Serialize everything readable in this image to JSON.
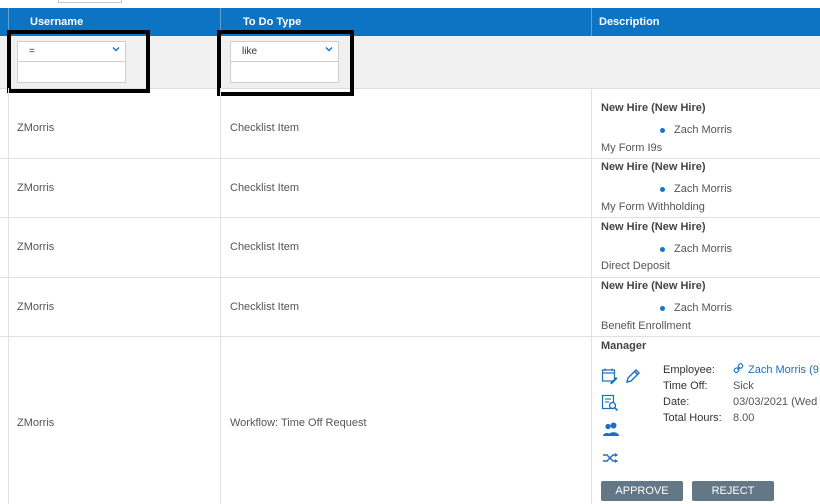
{
  "columns": [
    "Username",
    "To Do Type",
    "Description"
  ],
  "filters": {
    "username_operator": "=",
    "username_value": "",
    "todo_operator": "like",
    "todo_value": ""
  },
  "rows": [
    {
      "username": "ZMorris",
      "todo_type": "Checklist Item",
      "title": "New Hire (New Hire)",
      "person": "Zach Morris",
      "item": "My Form I9s"
    },
    {
      "username": "ZMorris",
      "todo_type": "Checklist Item",
      "title": "New Hire (New Hire)",
      "person": "Zach Morris",
      "item": "My Form Withholding"
    },
    {
      "username": "ZMorris",
      "todo_type": "Checklist Item",
      "title": "New Hire (New Hire)",
      "person": "Zach Morris",
      "item": "Direct Deposit"
    },
    {
      "username": "ZMorris",
      "todo_type": "Checklist Item",
      "title": "New Hire (New Hire)",
      "person": "Zach Morris",
      "item": "Benefit Enrollment"
    }
  ],
  "workflow_row": {
    "username": "ZMorris",
    "todo_type": "Workflow: Time Off Request",
    "title": "Manager",
    "employee_label": "Employee:",
    "employee_value": "Zach Morris (9",
    "timeoff_label": "Time Off:",
    "timeoff_value": "Sick",
    "date_label": "Date:",
    "date_value": "03/03/2021 (Wed",
    "hours_label": "Total Hours:",
    "hours_value": "8.00",
    "approve_label": "APPROVE",
    "reject_label": "REJECT"
  },
  "colors": {
    "header": "#0d74c4",
    "button": "#637787",
    "accent": "#1a73c5"
  },
  "icons": [
    "calendar-edit-icon",
    "pencil-icon",
    "document-search-icon",
    "users-icon",
    "shuffle-icon",
    "link-icon",
    "chevron-down-icon"
  ]
}
